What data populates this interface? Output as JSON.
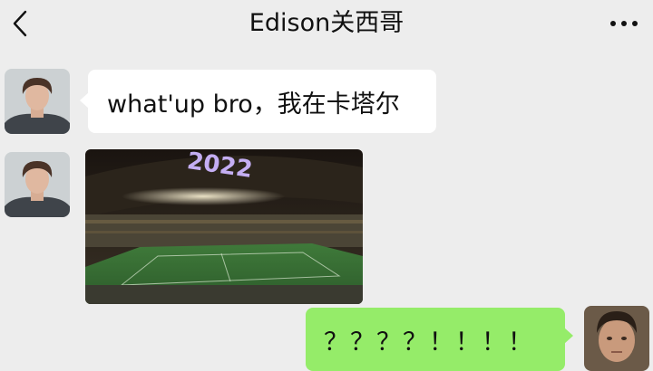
{
  "header": {
    "title": "Edison关西哥",
    "back_icon": "chevron-left-icon",
    "more_icon": "more-dots-icon"
  },
  "messages": [
    {
      "sender": "other",
      "type": "text",
      "text": "what'up bro，我在卡塔尔"
    },
    {
      "sender": "other",
      "type": "image",
      "image_content": "stadium-photo",
      "overlay_text": "2022"
    },
    {
      "sender": "me",
      "type": "text",
      "text": "？？？？！！！！"
    }
  ],
  "colors": {
    "background": "#ededed",
    "incoming_bubble": "#ffffff",
    "outgoing_bubble": "#95ec69"
  }
}
